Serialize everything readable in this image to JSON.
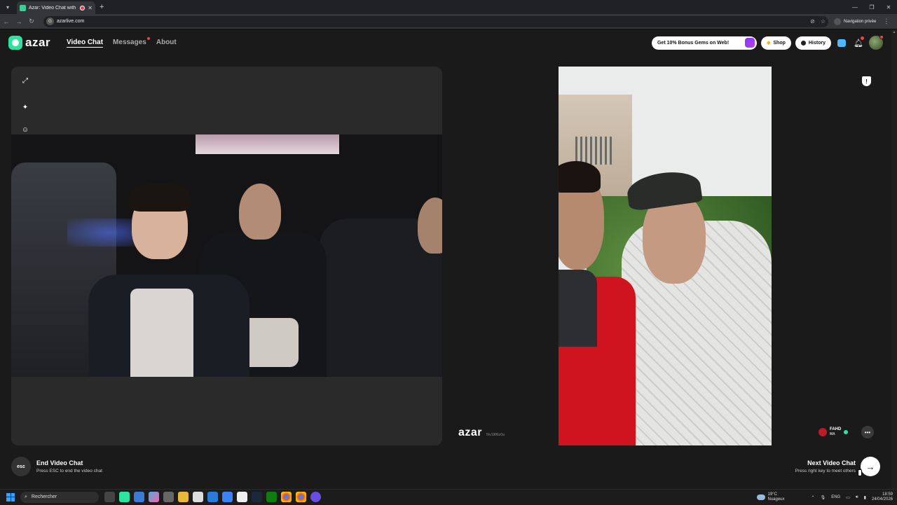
{
  "browser": {
    "tab_title": "Azar: Video Chat with New",
    "url": "azarlive.com",
    "private_label": "Navigation privée"
  },
  "header": {
    "logo_text": "azar",
    "nav": [
      "Video Chat",
      "Messages",
      "About"
    ],
    "bonus_label": "Get 10% Bonus Gems on Web!",
    "shop_label": "Shop",
    "history_label": "History"
  },
  "remote": {
    "brand": "azar",
    "user_id": "5tv1986z0a",
    "peer_name": "FAHD",
    "peer_country": "MA"
  },
  "bottom": {
    "esc_key": "esc",
    "end_title": "End Video Chat",
    "end_sub": "Press ESC to end the video chat",
    "next_title": "Next Video Chat",
    "next_sub": "Press right key to meet others"
  },
  "taskbar": {
    "search_placeholder": "Rechercher",
    "temp": "19°C",
    "weather": "Nuageux",
    "lang": "ENG",
    "time": "18:59",
    "date": "24/04/2026"
  },
  "colors": {
    "brand": "#2ee3a0",
    "notification": "#e44444"
  }
}
